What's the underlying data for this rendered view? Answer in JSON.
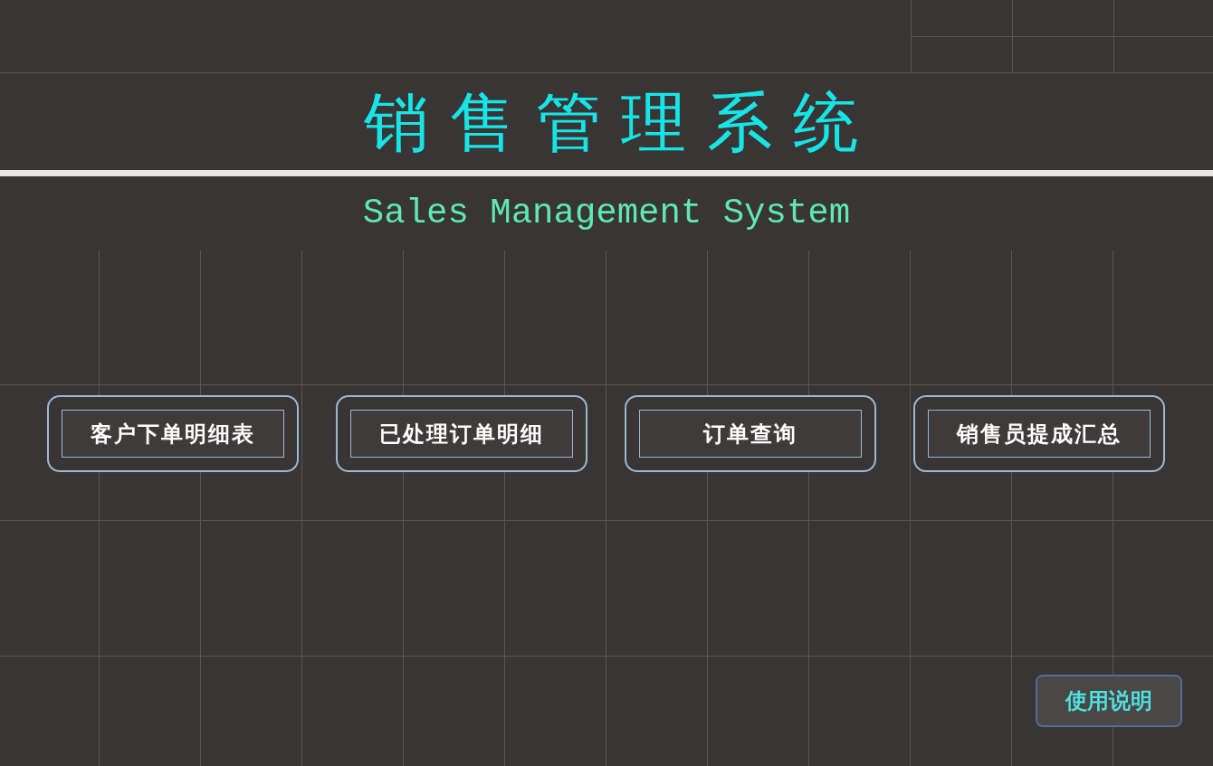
{
  "title": "销 售 管 理 系 统",
  "subtitle": "Sales Management System",
  "menu_buttons": [
    {
      "label": "客户下单明细表"
    },
    {
      "label": "已处理订单明细"
    },
    {
      "label": "订单查询"
    },
    {
      "label": "销售员提成汇总"
    }
  ],
  "help_button": {
    "label": "使用说明"
  }
}
